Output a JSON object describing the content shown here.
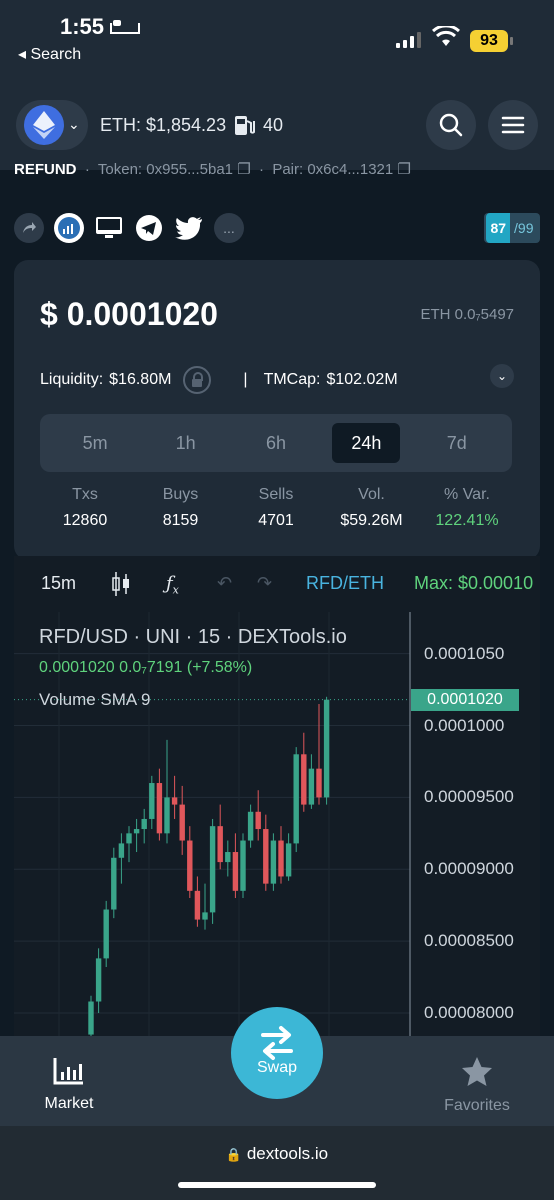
{
  "status": {
    "time": "1:55",
    "back_label": "◂ Search",
    "battery": "93"
  },
  "header": {
    "eth_price": "ETH: $1,854.23",
    "gas": "40",
    "token_line": {
      "symbol": "REFUND",
      "token": "Token: 0x955...5ba1",
      "pair": "Pair: 0x6c4...1321"
    }
  },
  "score": {
    "value": "87",
    "total": "/99"
  },
  "price": {
    "usd": "$ 0.0001020",
    "eth": "ETH 0.0₇5497",
    "liquidity_label": "Liquidity:",
    "liquidity_value": "$16.80M",
    "separator": "|",
    "tmcap_label": "TMCap:",
    "tmcap_value": "$102.02M"
  },
  "periods": [
    "5m",
    "1h",
    "6h",
    "24h",
    "7d"
  ],
  "active_period": "24h",
  "stats": [
    {
      "label": "Txs",
      "value": "12860"
    },
    {
      "label": "Buys",
      "value": "8159"
    },
    {
      "label": "Sells",
      "value": "4701"
    },
    {
      "label": "Vol.",
      "value": "$59.26M"
    },
    {
      "label": "% Var.",
      "value": "122.41%"
    }
  ],
  "chart_toolbar": {
    "interval": "15m",
    "pair": "RFD/ETH",
    "max": "Max: $0.00010"
  },
  "chart_data": {
    "type": "candlestick",
    "title": "RFD/USD · UNI · 15 · DEXTools.io",
    "last_change": "0.0001020  0.0₇7191 (+7.58%)",
    "indicator": "Volume SMA 9",
    "last_price_label": "0.0001020",
    "y_ticks": [
      "0.0001050",
      "0.0001000",
      "0.00009500",
      "0.00009000",
      "0.00008500",
      "0.00008000"
    ],
    "ylim": [
      7.84e-05,
      0.0001079
    ],
    "colors": {
      "up": "#3aa58a",
      "down": "#e0575b"
    },
    "candles": [
      {
        "o": 7.85e-05,
        "h": 8.12e-05,
        "l": 7.8e-05,
        "c": 8.08e-05
      },
      {
        "o": 8.08e-05,
        "h": 8.45e-05,
        "l": 8e-05,
        "c": 8.38e-05
      },
      {
        "o": 8.38e-05,
        "h": 8.78e-05,
        "l": 8.32e-05,
        "c": 8.72e-05
      },
      {
        "o": 8.72e-05,
        "h": 9.15e-05,
        "l": 8.66e-05,
        "c": 9.08e-05
      },
      {
        "o": 9.08e-05,
        "h": 9.25e-05,
        "l": 8.9e-05,
        "c": 9.18e-05
      },
      {
        "o": 9.18e-05,
        "h": 9.3e-05,
        "l": 9.05e-05,
        "c": 9.25e-05
      },
      {
        "o": 9.25e-05,
        "h": 9.35e-05,
        "l": 9.12e-05,
        "c": 9.28e-05
      },
      {
        "o": 9.28e-05,
        "h": 9.42e-05,
        "l": 9.18e-05,
        "c": 9.35e-05
      },
      {
        "o": 9.35e-05,
        "h": 9.65e-05,
        "l": 9.28e-05,
        "c": 9.6e-05
      },
      {
        "o": 9.6e-05,
        "h": 9.7e-05,
        "l": 9.2e-05,
        "c": 9.25e-05
      },
      {
        "o": 9.25e-05,
        "h": 9.9e-05,
        "l": 9.18e-05,
        "c": 9.5e-05
      },
      {
        "o": 9.5e-05,
        "h": 9.65e-05,
        "l": 9.35e-05,
        "c": 9.45e-05
      },
      {
        "o": 9.45e-05,
        "h": 9.58e-05,
        "l": 9.1e-05,
        "c": 9.2e-05
      },
      {
        "o": 9.2e-05,
        "h": 9.3e-05,
        "l": 8.8e-05,
        "c": 8.85e-05
      },
      {
        "o": 8.85e-05,
        "h": 8.95e-05,
        "l": 8.6e-05,
        "c": 8.65e-05
      },
      {
        "o": 8.65e-05,
        "h": 8.9e-05,
        "l": 8.58e-05,
        "c": 8.7e-05
      },
      {
        "o": 8.7e-05,
        "h": 9.35e-05,
        "l": 8.62e-05,
        "c": 9.3e-05
      },
      {
        "o": 9.3e-05,
        "h": 9.45e-05,
        "l": 9e-05,
        "c": 9.05e-05
      },
      {
        "o": 9.05e-05,
        "h": 9.2e-05,
        "l": 8.95e-05,
        "c": 9.12e-05
      },
      {
        "o": 9.12e-05,
        "h": 9.25e-05,
        "l": 8.8e-05,
        "c": 8.85e-05
      },
      {
        "o": 8.85e-05,
        "h": 9.25e-05,
        "l": 8.8e-05,
        "c": 9.2e-05
      },
      {
        "o": 9.2e-05,
        "h": 9.45e-05,
        "l": 9.15e-05,
        "c": 9.4e-05
      },
      {
        "o": 9.4e-05,
        "h": 9.55e-05,
        "l": 9.2e-05,
        "c": 9.28e-05
      },
      {
        "o": 9.28e-05,
        "h": 9.38e-05,
        "l": 8.85e-05,
        "c": 8.9e-05
      },
      {
        "o": 8.9e-05,
        "h": 9.25e-05,
        "l": 8.85e-05,
        "c": 9.2e-05
      },
      {
        "o": 9.2e-05,
        "h": 9.3e-05,
        "l": 8.9e-05,
        "c": 8.95e-05
      },
      {
        "o": 8.95e-05,
        "h": 9.25e-05,
        "l": 8.92e-05,
        "c": 9.18e-05
      },
      {
        "o": 9.18e-05,
        "h": 9.85e-05,
        "l": 9.12e-05,
        "c": 9.8e-05
      },
      {
        "o": 9.8e-05,
        "h": 9.95e-05,
        "l": 9.4e-05,
        "c": 9.45e-05
      },
      {
        "o": 9.45e-05,
        "h": 9.8e-05,
        "l": 9.42e-05,
        "c": 9.7e-05
      },
      {
        "o": 9.7e-05,
        "h": 0.0001015,
        "l": 9.45e-05,
        "c": 9.5e-05
      },
      {
        "o": 9.5e-05,
        "h": 0.000102,
        "l": 9.45e-05,
        "c": 0.0001018
      }
    ]
  },
  "nav": {
    "market": "Market",
    "swap": "Swap",
    "favorites": "Favorites"
  },
  "safari": {
    "url": "dextools.io"
  }
}
